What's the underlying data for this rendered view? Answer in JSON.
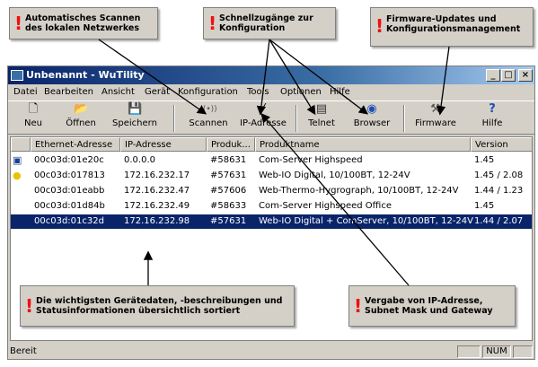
{
  "callouts": {
    "scan": "Automatisches Scannen des lokalen Netzwerkes",
    "shortcuts": "Schnellzugänge zur Konfiguration",
    "firmware": "Firmware-Updates und Konfigurationsmanagement",
    "devices": "Die wichtigsten Gerätedaten, -beschreibungen und Statusinformationen übersichtlich sortiert",
    "ip": "Vergabe von IP-Adresse, Subnet Mask und Gateway",
    "exclamation": "!"
  },
  "window": {
    "title": "Unbenannt - WuTility",
    "minimize": "_",
    "maximize": "□",
    "close": "×"
  },
  "menu": [
    "Datei",
    "Bearbeiten",
    "Ansicht",
    "Gerät",
    "Konfiguration",
    "Tools",
    "Optionen",
    "Hilfe"
  ],
  "toolbar": [
    {
      "label": "Neu",
      "icon": "new-document-icon",
      "glyph": "🗋"
    },
    {
      "label": "Öffnen",
      "icon": "open-folder-icon",
      "glyph": "📂"
    },
    {
      "label": "Speichern",
      "icon": "save-disk-icon",
      "glyph": "💾"
    },
    {
      "label": "Scannen",
      "icon": "scan-signal-icon",
      "glyph": "((•))"
    },
    {
      "label": "IP-Adresse",
      "icon": "magic-wand-icon",
      "glyph": "⁄"
    },
    {
      "label": "Telnet",
      "icon": "terminal-icon",
      "glyph": "▤"
    },
    {
      "label": "Browser",
      "icon": "globe-icon",
      "glyph": "◉"
    },
    {
      "label": "Firmware",
      "icon": "wrench-icon",
      "glyph": "⚒"
    },
    {
      "label": "Hilfe",
      "icon": "help-icon",
      "glyph": "?"
    }
  ],
  "table": {
    "headers": [
      "Ethernet-Adresse",
      "IP-Adresse",
      "Produk...",
      "Produktname",
      "Version"
    ],
    "rows": [
      {
        "icon": "device-icon",
        "mac": "00c03d:01e20c",
        "ip": "0.0.0.0",
        "product": "#58631",
        "name": "Com-Server Highspeed",
        "version": "1.45",
        "selected": false
      },
      {
        "icon": "lightbulb-icon",
        "mac": "00c03d:017813",
        "ip": "172.16.232.17",
        "product": "#57631",
        "name": "Web-IO Digital, 10/100BT, 12-24V",
        "version": "1.45 / 2.08",
        "selected": false
      },
      {
        "icon": "",
        "mac": "00c03d:01eabb",
        "ip": "172.16.232.47",
        "product": "#57606",
        "name": "Web-Thermo-Hygrograph, 10/100BT, 12-24V",
        "version": "1.44 / 1.23",
        "selected": false
      },
      {
        "icon": "",
        "mac": "00c03d:01d84b",
        "ip": "172.16.232.49",
        "product": "#58633",
        "name": "Com-Server Highspeed Office",
        "version": "1.45",
        "selected": false
      },
      {
        "icon": "",
        "mac": "00c03d:01c32d",
        "ip": "172.16.232.98",
        "product": "#57631",
        "name": "Web-IO Digital + ComServer, 10/100BT, 12-24V",
        "version": "1.44 / 2.07",
        "selected": true
      }
    ]
  },
  "status": {
    "text": "Bereit",
    "num": "NUM"
  },
  "colors": {
    "titlebar": "#0a246a",
    "selection": "#0a246a",
    "accent_red": "#e11111",
    "chrome": "#d4d0c8"
  }
}
